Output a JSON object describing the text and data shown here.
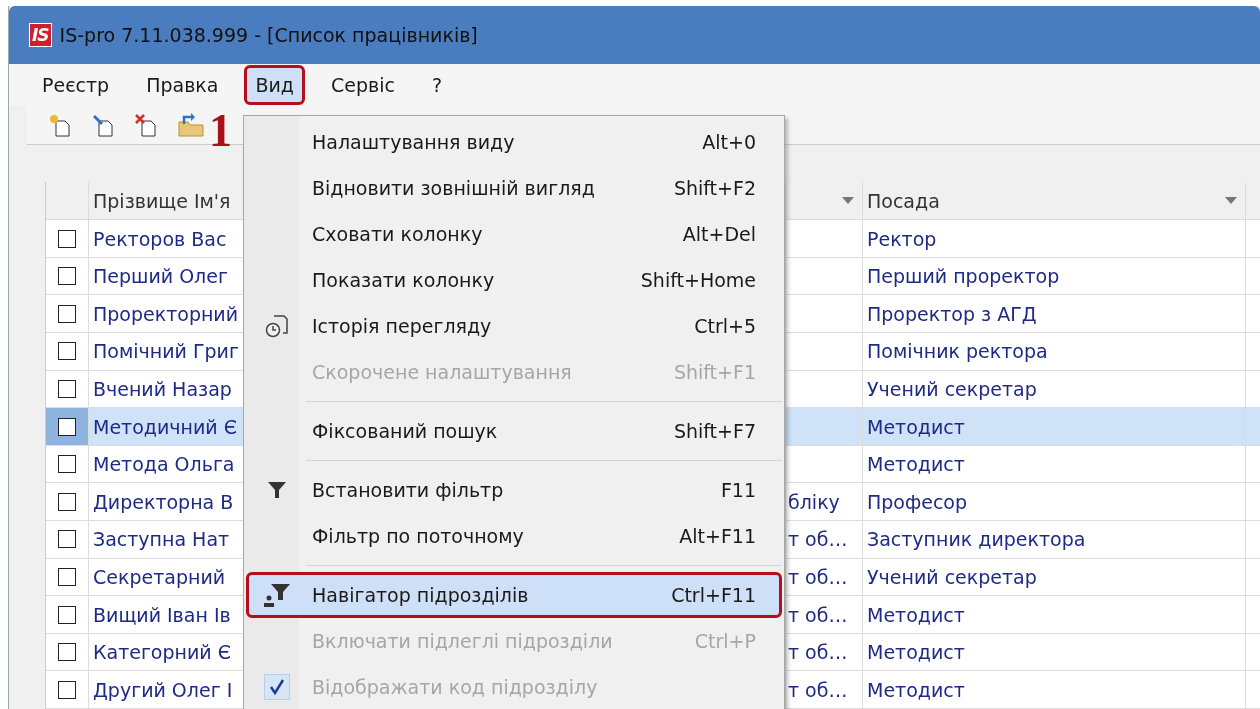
{
  "window": {
    "logo": "IS",
    "title": "IS-pro 7.11.038.999 - [Список працівників]"
  },
  "menu_bar": [
    {
      "label": "Реєстр",
      "selected": false,
      "outlined": false
    },
    {
      "label": "Правка",
      "selected": false,
      "outlined": false
    },
    {
      "label": "Вид",
      "selected": true,
      "outlined": true
    },
    {
      "label": "Сервіс",
      "selected": false,
      "outlined": false
    },
    {
      "label": "?",
      "selected": false,
      "outlined": false
    }
  ],
  "annotation": "1",
  "table": {
    "columns": [
      {
        "label": "Прізвище Ім'я"
      },
      {
        "filter": true
      },
      {
        "label": "Посада",
        "filter": true
      }
    ],
    "rows": [
      {
        "checked": false,
        "selected": false,
        "name": "Ректоров Вас",
        "position": "Ректор"
      },
      {
        "checked": false,
        "selected": false,
        "name": "Перший Олег",
        "position": "Перший проректор"
      },
      {
        "checked": false,
        "selected": false,
        "name": "Проректорний",
        "position": "Проректор з АГД"
      },
      {
        "checked": false,
        "selected": false,
        "name": "Помічний Григ",
        "position": "Помічник ректора"
      },
      {
        "checked": false,
        "selected": false,
        "name": "Вчений Назар",
        "position": "Учений секретар"
      },
      {
        "checked": false,
        "selected": true,
        "name": "Методичний Є",
        "position": "Методист"
      },
      {
        "checked": false,
        "selected": false,
        "name": "Метода Ольга",
        "position": "Методист"
      },
      {
        "checked": false,
        "selected": false,
        "name": "Директорна В",
        "column_2": "бліку",
        "position": "Професор"
      },
      {
        "checked": false,
        "selected": false,
        "name": "Заступна Нат",
        "column_2": "т об…",
        "position": "Заступник директора"
      },
      {
        "checked": false,
        "selected": false,
        "name": "Секретарний",
        "column_2": "т об…",
        "position": "Учений секретар"
      },
      {
        "checked": false,
        "selected": false,
        "name": "Вищий Іван Ів",
        "column_2": "т об…",
        "position": "Методист"
      },
      {
        "checked": false,
        "selected": false,
        "name": "Категорний Є",
        "column_2": "т об…",
        "position": "Методист"
      },
      {
        "checked": false,
        "selected": false,
        "name": "Другий Олег І",
        "column_2": "т об…",
        "position": "Методист"
      }
    ]
  },
  "view_menu": {
    "items": [
      {
        "kind": "command",
        "label": "Налаштування виду",
        "shortcut": "Alt+0",
        "disabled": false,
        "selected": false,
        "outlined": false,
        "checked": false
      },
      {
        "kind": "command",
        "label": "Відновити зовнішній вигляд",
        "shortcut": "Shift+F2",
        "disabled": false,
        "selected": false,
        "outlined": false,
        "checked": false
      },
      {
        "kind": "command",
        "label": "Сховати колонку",
        "shortcut": "Alt+Del",
        "disabled": false,
        "selected": false,
        "outlined": false,
        "checked": false
      },
      {
        "kind": "command",
        "label": "Показати колонку",
        "shortcut": "Shift+Home",
        "disabled": false,
        "selected": false,
        "outlined": false,
        "checked": false
      },
      {
        "kind": "command",
        "label": "Історія перегляду",
        "shortcut": "Ctrl+5",
        "disabled": false,
        "selected": false,
        "outlined": false,
        "checked": false
      },
      {
        "kind": "command",
        "label": "Скорочене налаштування",
        "shortcut": "Shift+F1",
        "disabled": true,
        "selected": false,
        "outlined": false,
        "checked": false
      },
      {
        "kind": "separator"
      },
      {
        "kind": "command",
        "label": "Фіксований пошук",
        "shortcut": "Shift+F7",
        "disabled": false,
        "selected": false,
        "outlined": false,
        "checked": false
      },
      {
        "kind": "separator"
      },
      {
        "kind": "command",
        "label": "Встановити фільтр",
        "shortcut": "F11",
        "disabled": false,
        "selected": false,
        "outlined": false,
        "checked": false
      },
      {
        "kind": "command",
        "label": "Фільтр по поточному",
        "shortcut": "Alt+F11",
        "disabled": false,
        "selected": false,
        "outlined": false,
        "checked": false
      },
      {
        "kind": "separator"
      },
      {
        "kind": "command",
        "label": "Навігатор підрозділів",
        "shortcut": "Ctrl+F11",
        "disabled": false,
        "selected": true,
        "outlined": true,
        "checked": false
      },
      {
        "kind": "command",
        "label": "Включати підлеглі підрозділи",
        "shortcut": "Ctrl+P",
        "disabled": true,
        "selected": false,
        "outlined": false,
        "checked": false
      },
      {
        "kind": "command",
        "label": "Відображати код підрозділу",
        "disabled": true,
        "selected": false,
        "outlined": false,
        "checked": true
      }
    ]
  }
}
